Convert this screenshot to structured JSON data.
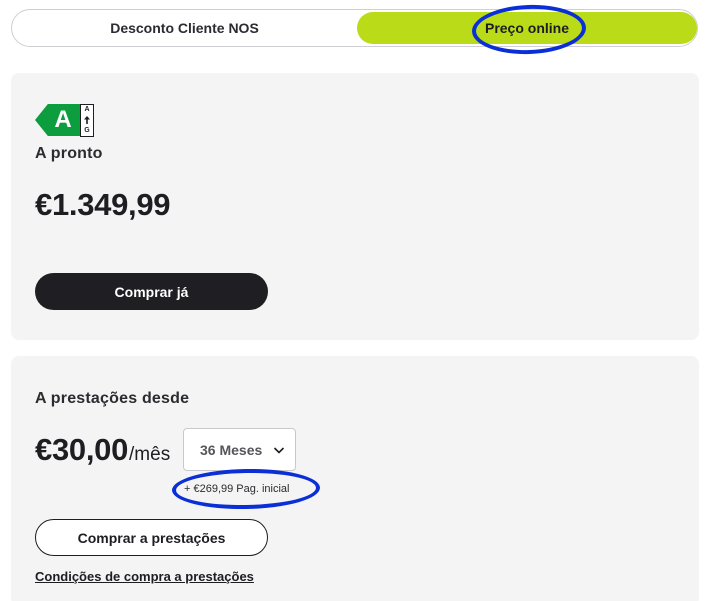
{
  "toggle": {
    "options": [
      "Desconto Cliente NOS",
      "Preço online"
    ],
    "selected": "Preço online"
  },
  "colors": {
    "accent": "#badb17",
    "dark_button": "#1e1e23",
    "energy_green": "#0c9d3f",
    "marker_blue": "#0b2fd6"
  },
  "cash_card": {
    "energy_class": "A",
    "energy_scale_top": "A",
    "energy_scale_bottom": "G",
    "label": "A pronto",
    "price": "€1.349,99",
    "buy_button": "Comprar já"
  },
  "installments_card": {
    "label": "A prestações desde",
    "monthly_amount": "€30,00",
    "monthly_unit": "/mês",
    "months_select": {
      "selected": "36 Meses"
    },
    "down_payment": "+ €269,99 Pag. inicial",
    "buy_button": "Comprar a prestações",
    "conditions_link": "Condições de compra a prestações"
  },
  "icons": {
    "energy_arrow": "up-arrow-icon",
    "select": "chevron-down-icon"
  }
}
